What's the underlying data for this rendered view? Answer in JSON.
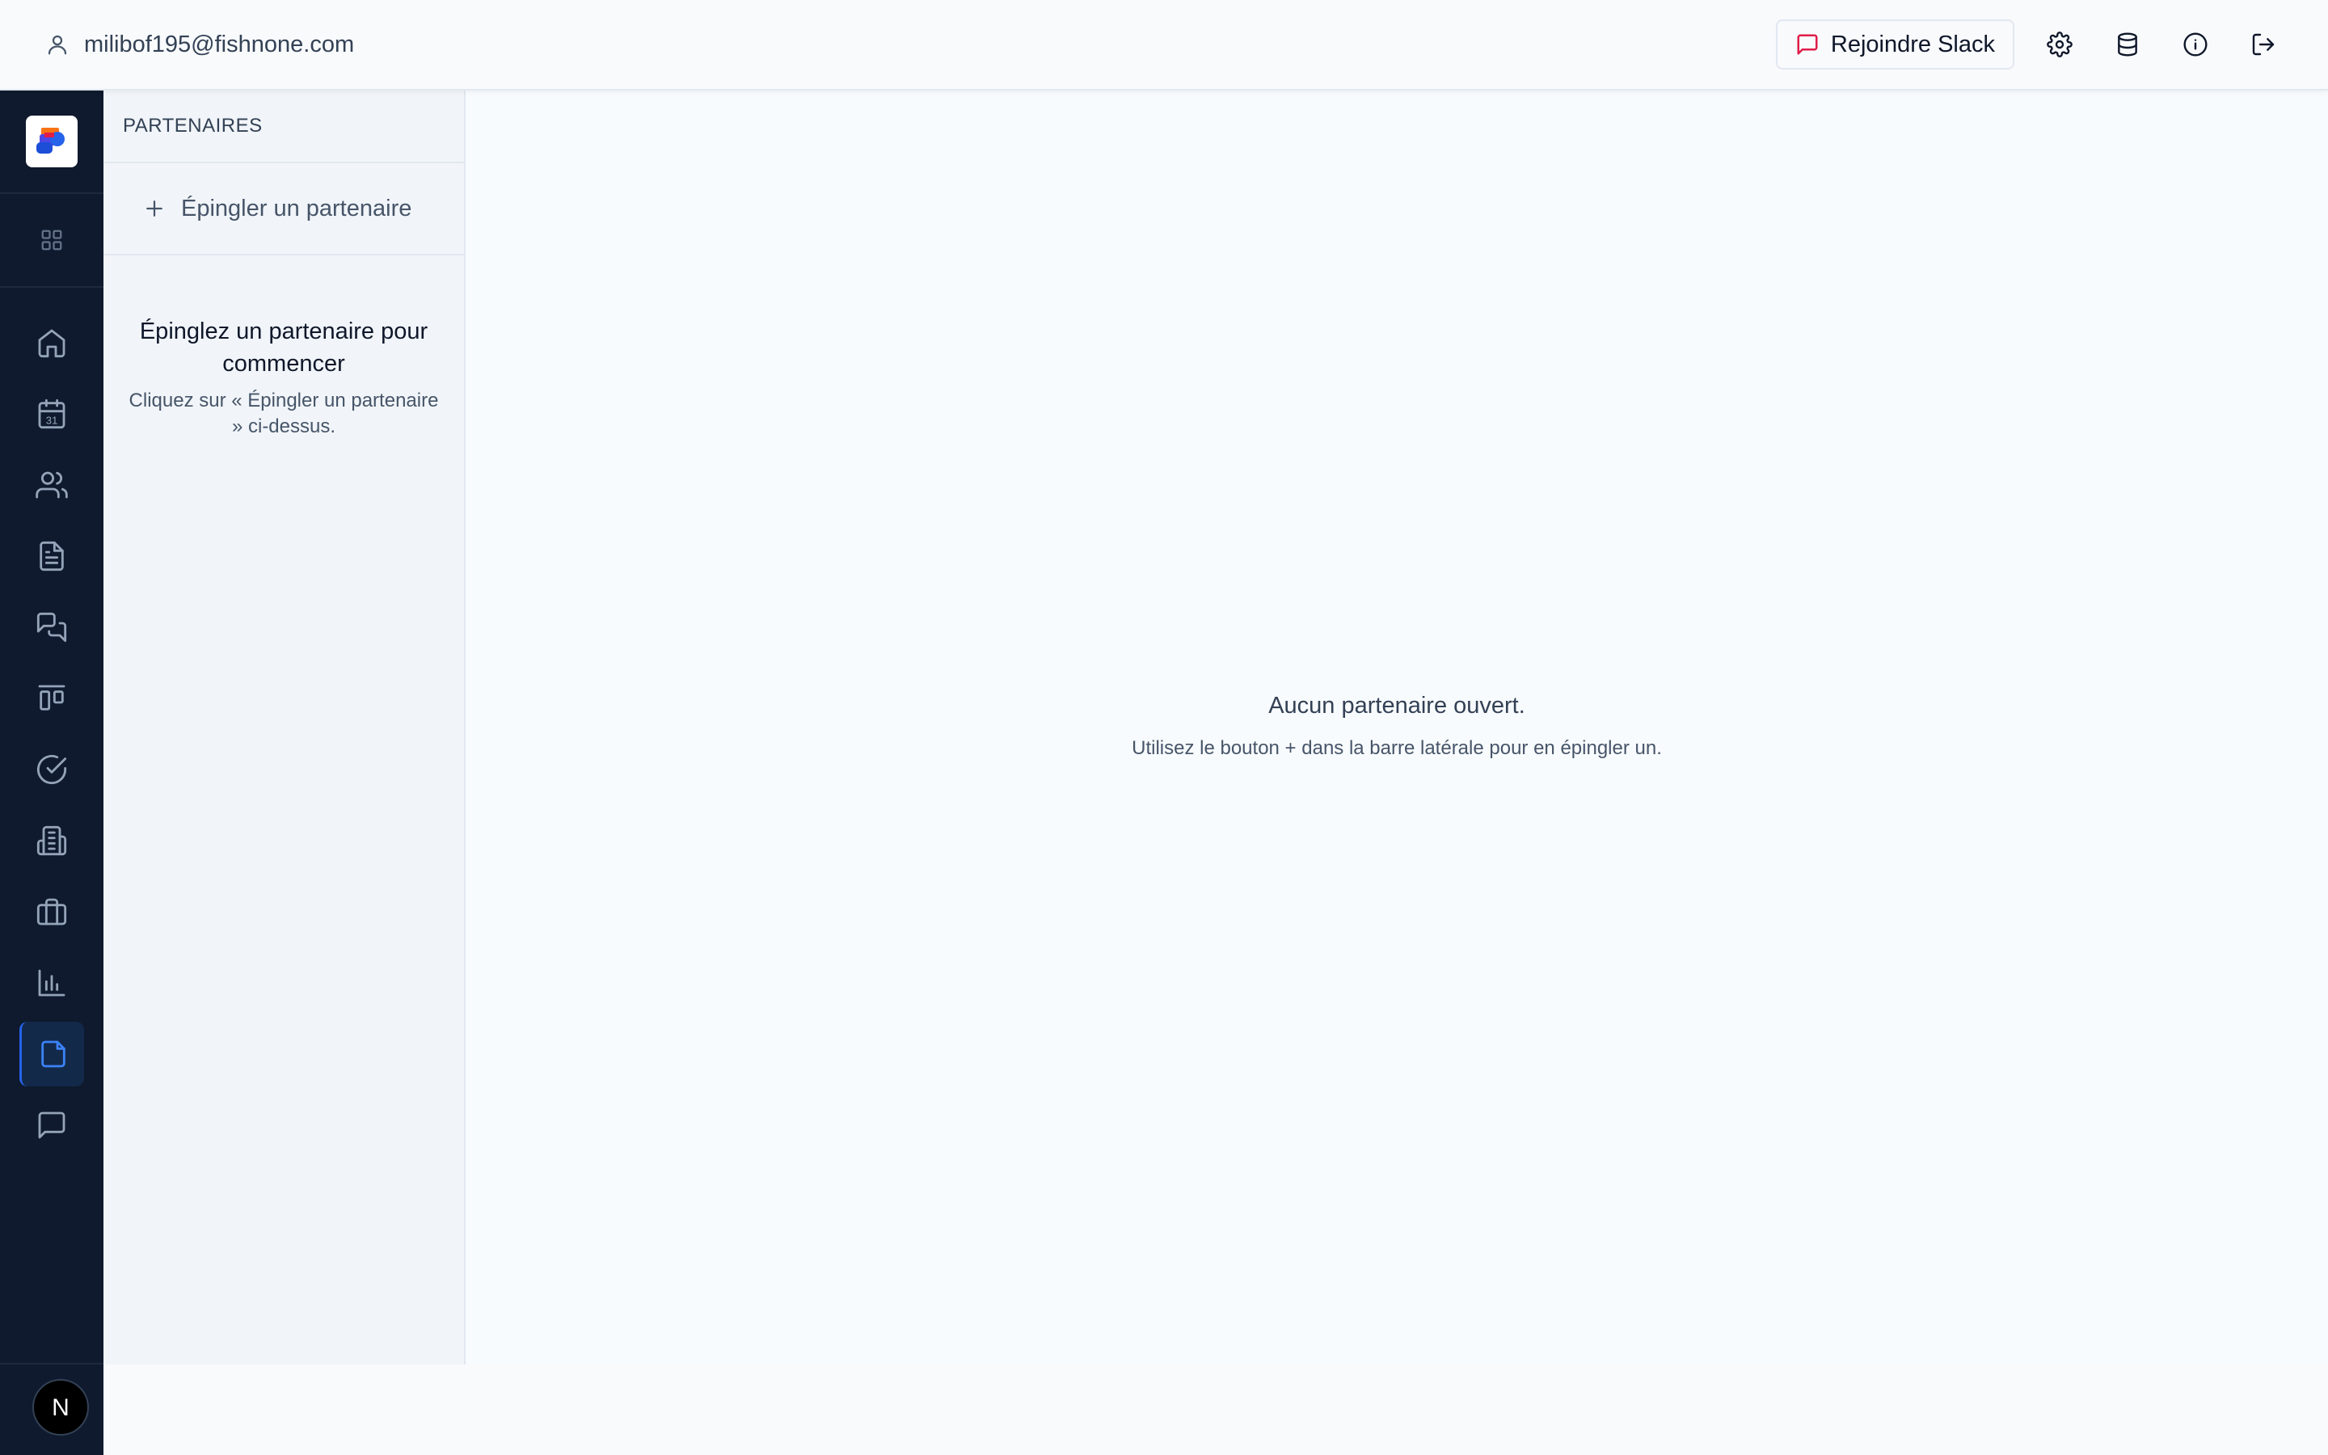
{
  "header": {
    "user_email": "milibof195@fishnone.com",
    "slack_label": "Rejoindre Slack",
    "icons": [
      "user-icon",
      "message-icon",
      "gear-icon",
      "database-icon",
      "info-icon",
      "logout-icon"
    ]
  },
  "rail": {
    "logo": "app-logo",
    "items": [
      "home-icon",
      "calendar-icon",
      "users-icon",
      "document-icon",
      "chat-icon",
      "kanban-icon",
      "check-circle-icon",
      "building-icon",
      "briefcase-icon",
      "bar-chart-icon",
      "file-icon",
      "comment-icon"
    ],
    "active_index": 10,
    "calendar_day": "31",
    "avatar_letter": "N"
  },
  "panel": {
    "title": "PARTENAIRES",
    "pin_label": "Épingler un partenaire",
    "empty_title": "Épinglez un partenaire pour commencer",
    "empty_subtitle": "Cliquez sur « Épingler un partenaire » ci-dessus."
  },
  "main": {
    "empty_title": "Aucun partenaire ouvert.",
    "empty_subtitle": "Utilisez le bouton + dans la barre latérale pour en épingler un."
  },
  "colors": {
    "rail_bg": "#0f1a2e",
    "accent": "#2563eb",
    "slack_icon": "#e11d48"
  }
}
